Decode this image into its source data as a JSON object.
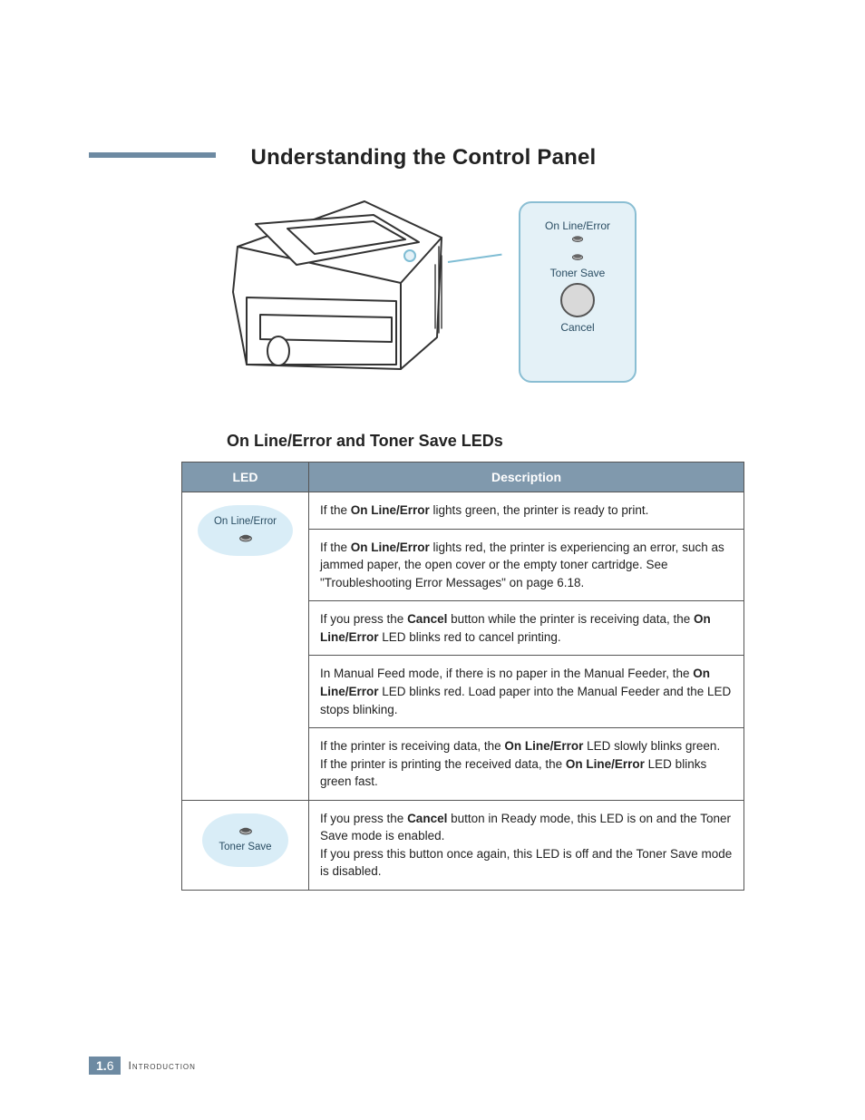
{
  "page": {
    "title": "Understanding the Control Panel",
    "subhead": "On Line/Error and Toner Save LEDs",
    "footer_page": "1.6",
    "footer_chapter": "Introduction"
  },
  "panel": {
    "led1": "On Line/Error",
    "led2": "Toner Save",
    "button": "Cancel"
  },
  "table": {
    "headers": {
      "led": "LED",
      "desc": "Description"
    },
    "icons": {
      "online_error": "On Line/Error",
      "toner_save": "Toner Save"
    },
    "rows": {
      "r1": {
        "pre": "If the ",
        "b1": "On Line/Error",
        "post": " lights green, the printer is ready to print."
      },
      "r2": {
        "pre": "If the ",
        "b1": "On Line/Error",
        "post": " lights red, the printer is experiencing an error, such as jammed paper, the open cover or the empty toner cartridge. See \"Troubleshooting Error Messages\" on page 6.18."
      },
      "r3": {
        "a_pre": "If you press the ",
        "a_b": "Cancel",
        "a_mid": " button while the printer is receiving data, the ",
        "a_b2": "On Line/Error",
        "a_post": " LED blinks red to cancel printing."
      },
      "r4": {
        "pre": "In Manual Feed mode, if there is no paper in the Manual Feeder, the ",
        "b1": "On Line/Error",
        "post": " LED blinks red. Load paper into the Manual Feeder and the LED stops blinking."
      },
      "r5": {
        "a_pre": "If the printer is receiving data, the ",
        "a_b": "On Line/Error",
        "a_post": " LED slowly blinks green.",
        "b_pre": "If the printer is printing the received data, the ",
        "b_b": "On Line/Error",
        "b_post": " LED blinks green fast."
      },
      "r6": {
        "a_pre": "If you press the ",
        "a_b": "Cancel",
        "a_post": " button in Ready mode, this LED is on and the Toner Save mode is enabled.",
        "b_text": "If you press this button once again, this LED is off and the Toner Save mode is disabled."
      }
    }
  }
}
